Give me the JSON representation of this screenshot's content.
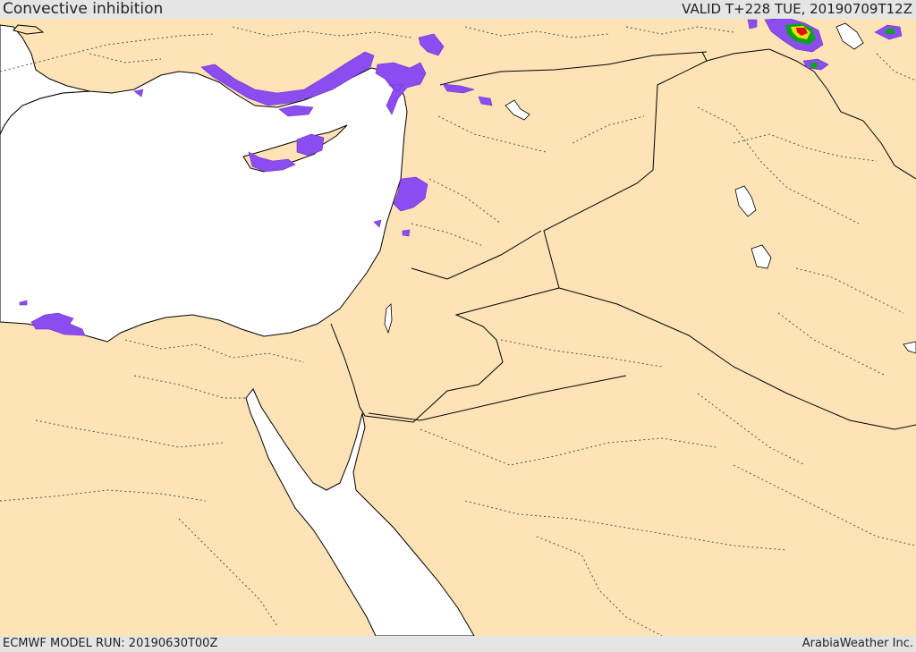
{
  "header": {
    "title": "Convective inhibition",
    "valid": "VALID T+228 TUE, 20190709T12Z"
  },
  "footer": {
    "model_run": "ECMWF MODEL RUN: 20190630T00Z",
    "credit": "ArabiaWeather Inc."
  },
  "colors": {
    "land": "#fde3b6",
    "water": "#ffffff",
    "cin_low": "#8b4cf0",
    "cin_mid": "#f0e000",
    "cin_high": "#e01010",
    "cin_peak": "#10a020",
    "bar": "#e5e5e5"
  }
}
